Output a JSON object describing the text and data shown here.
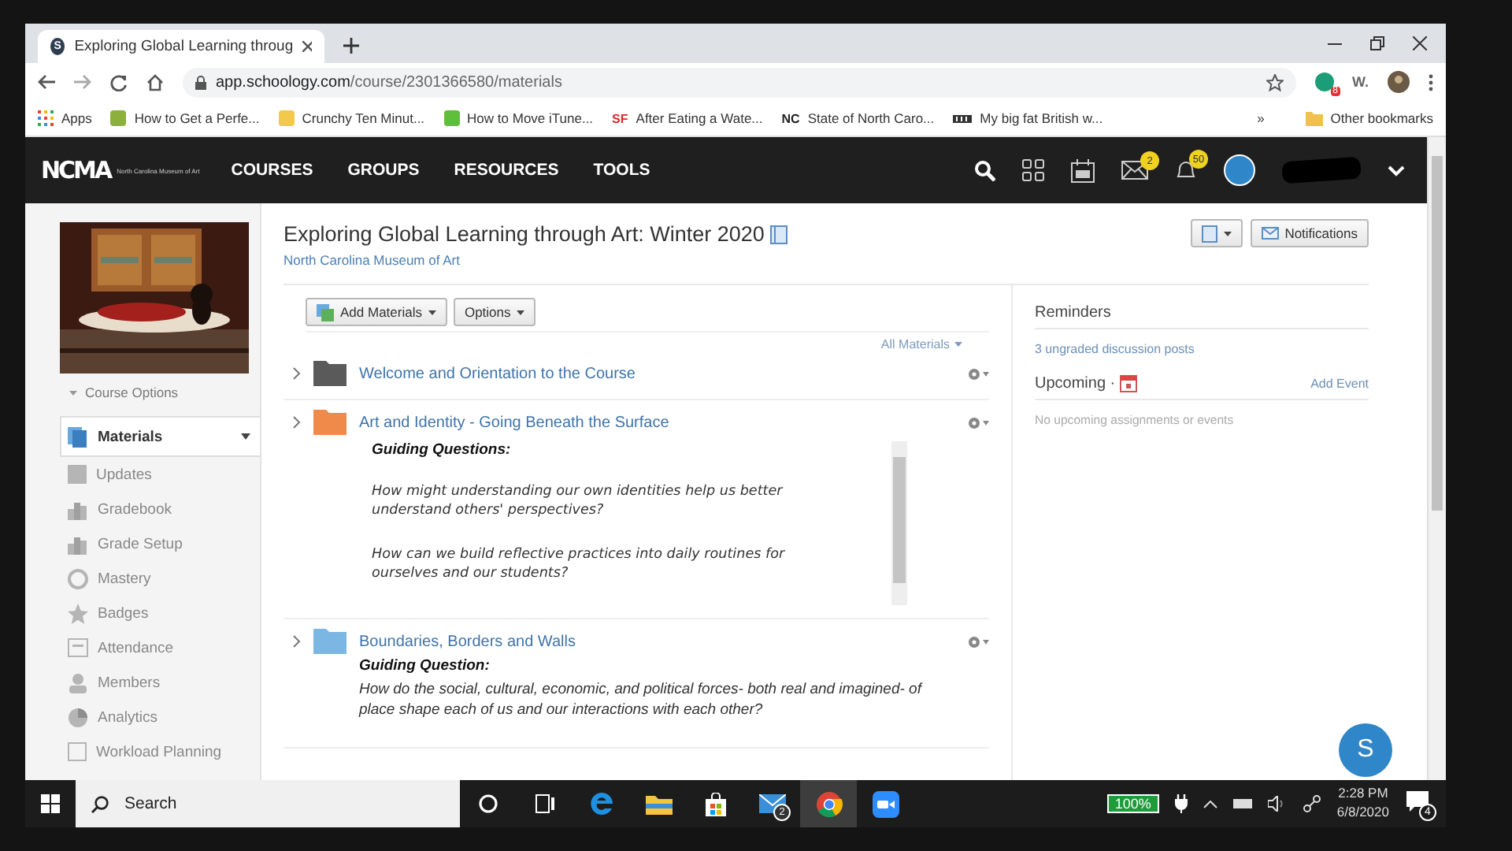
{
  "browser": {
    "tab": {
      "favicon": "S",
      "title": "Exploring Global Learning throug"
    },
    "url": {
      "host": "app.schoology.com",
      "path": "/course/2301366580/materials"
    },
    "extensions": [
      {
        "kind": "badge",
        "label": "8"
      },
      {
        "kind": "text",
        "label": "W."
      }
    ],
    "bookmarks": [
      {
        "kind": "apps",
        "label": "Apps"
      },
      {
        "kind": "square",
        "color": "#8bb13c",
        "label": "How to Get a Perfe..."
      },
      {
        "kind": "square",
        "color": "#f2c94c",
        "label": "Crunchy Ten Minut..."
      },
      {
        "kind": "square",
        "color": "#5fbf3a",
        "label": "How to Move iTune..."
      },
      {
        "kind": "text",
        "mark": "SF",
        "color": "#d62b2b",
        "label": "After Eating a Wate..."
      },
      {
        "kind": "text",
        "mark": "NC",
        "color": "#222222",
        "label": "State of North Caro..."
      },
      {
        "kind": "bar",
        "label": "My big fat British w..."
      }
    ],
    "more": "»",
    "other": "Other bookmarks"
  },
  "nav": {
    "logo": {
      "mark": "NCMA",
      "caption": "North Carolina Museum of Art"
    },
    "items": [
      "COURSES",
      "GROUPS",
      "RESOURCES",
      "TOOLS"
    ],
    "mail_badge": "2",
    "bell_badge": "50"
  },
  "sidebar": {
    "course_options": "Course Options",
    "items": [
      {
        "kind": "materials",
        "label": "Materials",
        "selected": true
      },
      {
        "kind": "updates",
        "label": "Updates",
        "selected": false
      },
      {
        "kind": "gradebook",
        "label": "Gradebook",
        "selected": false
      },
      {
        "kind": "setup",
        "label": "Grade Setup",
        "selected": false
      },
      {
        "kind": "mastery",
        "label": "Mastery",
        "selected": false
      },
      {
        "kind": "badges",
        "label": "Badges",
        "selected": false
      },
      {
        "kind": "attendance",
        "label": "Attendance",
        "selected": false
      },
      {
        "kind": "members",
        "label": "Members",
        "selected": false
      },
      {
        "kind": "analytics",
        "label": "Analytics",
        "selected": false
      },
      {
        "kind": "workload",
        "label": "Workload Planning",
        "selected": false
      }
    ]
  },
  "course": {
    "title": "Exploring Global Learning through Art: Winter 2020",
    "subtitle": "North Carolina Museum of Art",
    "notifications": "Notifications"
  },
  "materials": {
    "add": "Add Materials",
    "options": "Options",
    "filter": "All Materials",
    "folders": [
      {
        "title": "Welcome and Orientation to the Course",
        "color": "#5a5a5a"
      },
      {
        "title": "Art and Identity - Going Beneath the Surface",
        "color": "#f08a4b",
        "description": {
          "scrollable": true,
          "heading": "Guiding Questions:",
          "paragraphs": [
            "How might understanding our own identities help us better understand others' perspectives?",
            "How can we build reflective practices into daily routines for ourselves and our students?"
          ]
        }
      },
      {
        "title": "Boundaries, Borders and Walls",
        "color": "#7bb7e2",
        "description": {
          "scrollable": false,
          "heading": "Guiding Question:",
          "paragraphs": [
            "How do the social, cultural, economic, and political forces- both real and imagined- of place shape each of us and our interactions with each other?"
          ]
        }
      }
    ]
  },
  "reminders": {
    "title": "Reminders",
    "link": "3 ungraded discussion posts"
  },
  "upcoming": {
    "title": "Upcoming ·",
    "add": "Add Event",
    "empty": "No upcoming assignments or events"
  },
  "chat_button": "S",
  "taskbar": {
    "search": "Search",
    "apps": [
      {
        "kind": "cortana",
        "active": false
      },
      {
        "kind": "taskview",
        "active": false
      },
      {
        "kind": "edge",
        "active": false
      },
      {
        "kind": "explorer",
        "active": false
      },
      {
        "kind": "store",
        "active": false
      },
      {
        "kind": "mail",
        "active": false,
        "badge": "2"
      },
      {
        "kind": "chrome",
        "active": true
      },
      {
        "kind": "zoom",
        "active": false
      }
    ],
    "battery": "100%",
    "time": "2:28 PM",
    "date": "6/8/2020",
    "notifications": "4"
  }
}
